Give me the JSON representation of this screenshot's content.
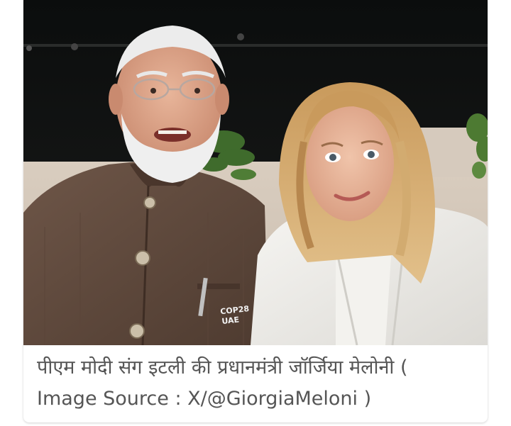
{
  "photo": {
    "badge_text_line1": "COP28",
    "badge_text_line2": "UAE"
  },
  "caption": {
    "line1": "पीएम मोदी संग इटली की प्रधानमंत्री जॉर्जिया मेलोनी (",
    "line2": "Image Source : X/@GiorgiaMeloni )"
  }
}
